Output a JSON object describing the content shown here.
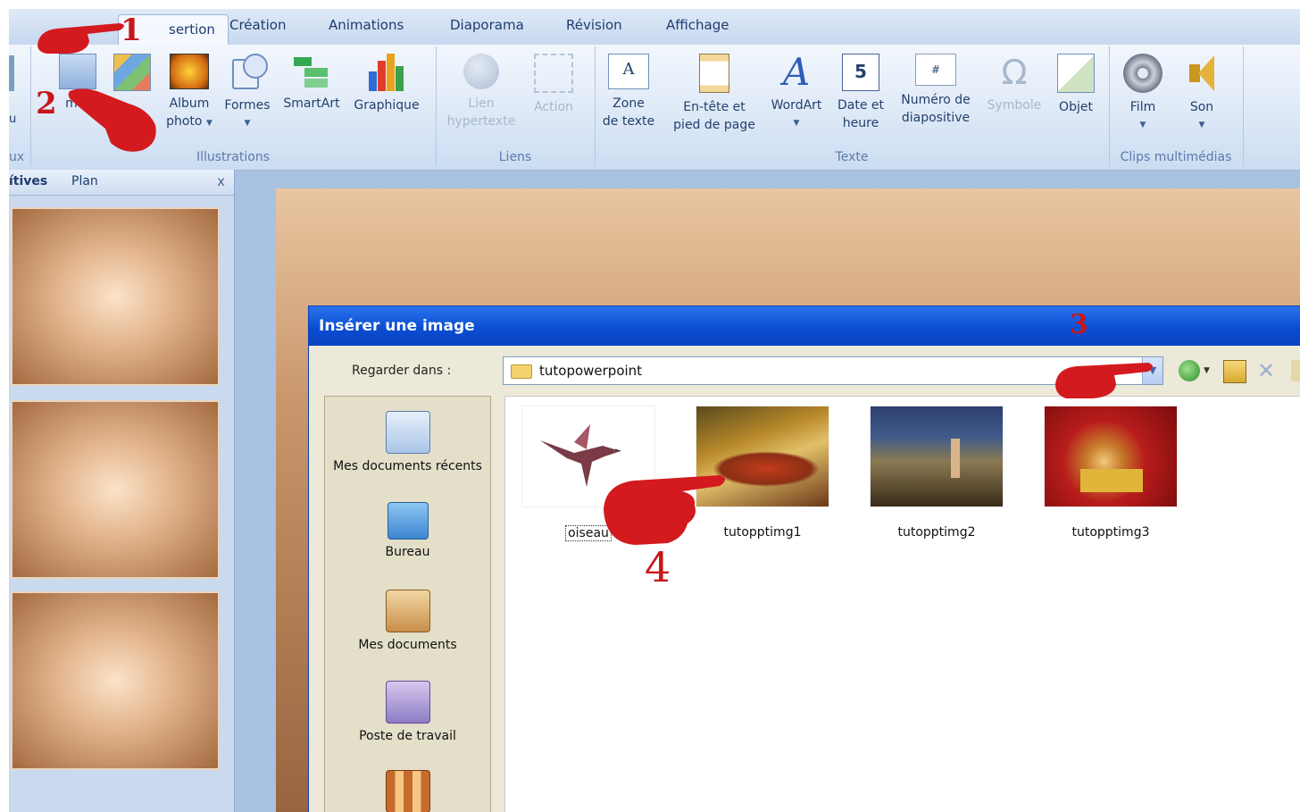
{
  "ribbon": {
    "tabs": [
      "Insertion",
      "Création",
      "Animations",
      "Diaporama",
      "Révision",
      "Affichage"
    ],
    "tab_partial": "sertion",
    "groups": {
      "illustrations": "Illustrations",
      "liens": "Liens",
      "texte": "Texte",
      "clips": "Clips multimédias"
    },
    "left_partial": {
      "top": "u",
      "bottom": "ux"
    },
    "buttons": {
      "image": "mage",
      "album": "Album",
      "album2": "photo",
      "formes": "Formes",
      "smartart": "SmartArt",
      "graphique": "Graphique",
      "lien": "Lien",
      "lien2": "hypertexte",
      "action": "Action",
      "zone": "Zone",
      "zone2": "de texte",
      "entete": "En-tête et",
      "entete2": "pied de page",
      "wordart": "WordArt",
      "date": "Date et",
      "date2": "heure",
      "numero": "Numéro de",
      "numero2": "diapositive",
      "symbole": "Symbole",
      "objet": "Objet",
      "film": "Film",
      "son": "Son"
    }
  },
  "left_pane": {
    "tab_slides": "ítives",
    "tab_plan": "Plan",
    "close": "x"
  },
  "dialog": {
    "title": "Insérer une image",
    "look_in_label": "Regarder dans :",
    "path": "tutopowerpoint",
    "places": [
      "Mes documents récents",
      "Bureau",
      "Mes documents",
      "Poste de travail"
    ],
    "files": [
      "oiseau",
      "tutopptimg1",
      "tutopptimg2",
      "tutopptimg3"
    ]
  },
  "annotations": {
    "n1": "1",
    "n2": "2",
    "n3": "3",
    "n4": "4"
  },
  "colors": {
    "annotation": "#c8161a",
    "dialog_title": "#0b4ed2",
    "slide_brown": "#b07a52"
  }
}
